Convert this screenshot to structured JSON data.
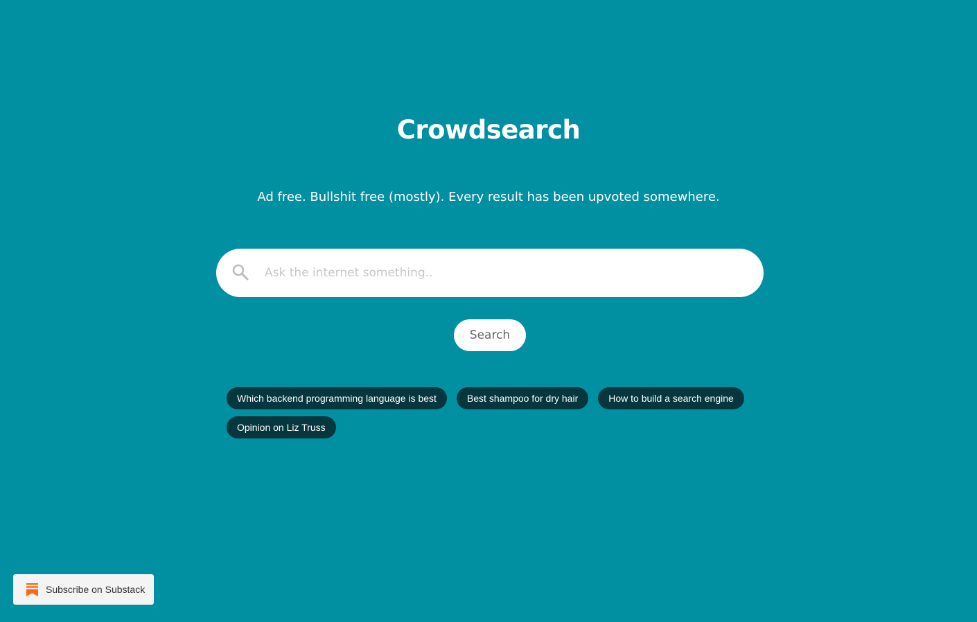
{
  "app": {
    "title": "Crowdsearch",
    "tagline": "Ad free. Bullshit free (mostly). Every result has been upvoted somewhere."
  },
  "search": {
    "placeholder": "Ask the internet something..",
    "value": "",
    "icon": "search-icon",
    "button_label": "Search"
  },
  "suggestions": [
    {
      "label": "Which backend programming language is best"
    },
    {
      "label": "Best shampoo for dry hair"
    },
    {
      "label": "How to build a search engine"
    },
    {
      "label": "Opinion on Liz Truss"
    }
  ],
  "substack": {
    "label": "Subscribe on Substack",
    "icon": "substack-icon"
  },
  "colors": {
    "background": "#0090a1",
    "chip": "#06363e",
    "substack_brand": "#ff6719"
  }
}
